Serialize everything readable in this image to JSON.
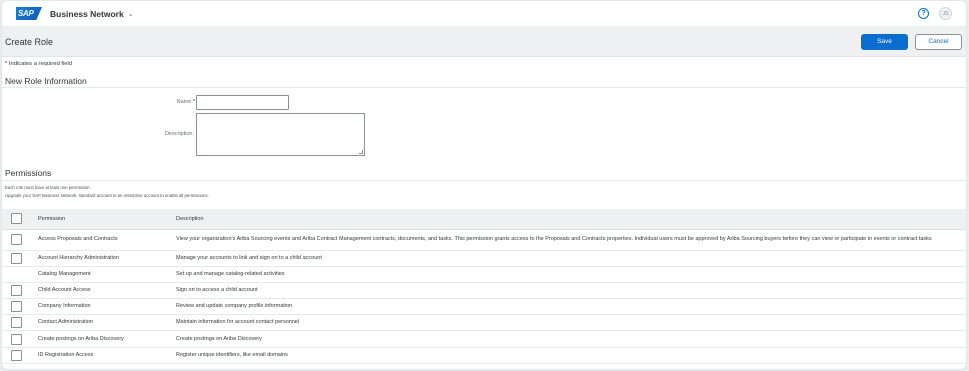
{
  "shell": {
    "logo_text": "SAP",
    "product_name": "Business Network",
    "caret": "⌄",
    "help": "?",
    "avatar_initials": "JS"
  },
  "header": {
    "title": "Create Role",
    "save_label": "Save",
    "cancel_label": "Cancel"
  },
  "required_note": {
    "star": "*",
    "text": " Indicates a required field"
  },
  "role_info": {
    "section_title": "New Role Information",
    "name_label": "Name:",
    "name_star": "*",
    "name_value": "",
    "description_label": "Description:",
    "description_value": ""
  },
  "permissions": {
    "section_title": "Permissions",
    "note_1": "Each role must have at least one permission.",
    "note_2": "Upgrade your SAP Business Network, standard account to an enterprise account to enable all permissions.",
    "col_permission": "Permission",
    "col_description": "Description",
    "rows": [
      {
        "permission": "Access Proposals and Contracts",
        "description": "View your organization's Ariba Sourcing events and Ariba Contract Management contracts, documents, and tasks. This permission grants access to the Proposals and Contracts properties. Individual users must be approved by Ariba Sourcing buyers before they can view or participate in events or contract tasks"
      },
      {
        "permission": "Account Hierarchy Administration",
        "description": "Manage your accounts to link and sign on to a child account"
      },
      {
        "permission": "Catalog Management",
        "description": "Set up and manage catalog-related activities"
      },
      {
        "permission": "Child Account Access",
        "description": "Sign on to access a child account"
      },
      {
        "permission": "Company Information",
        "description": "Review and update company profile information"
      },
      {
        "permission": "Contact Administration",
        "description": "Maintain information for account contact personnel"
      },
      {
        "permission": "Create postings on Ariba Discovery",
        "description": "Create postings on Ariba Discovery"
      },
      {
        "permission": "ID Registration Access",
        "description": "Register unique identifiers, like email domains"
      }
    ]
  },
  "colors": {
    "accent": "#0a6ed1",
    "required": "#bb0000",
    "header_bg": "#eff0f1"
  }
}
